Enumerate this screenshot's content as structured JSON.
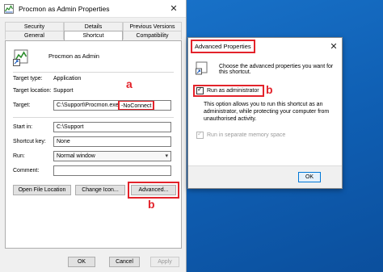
{
  "window_main": {
    "title": "Procmon as Admin Properties",
    "close_glyph": "✕",
    "tabs_row1": [
      "Security",
      "Details",
      "Previous Versions"
    ],
    "tabs_row2": [
      "General",
      "Shortcut",
      "Compatibility"
    ],
    "active_tab": "Shortcut",
    "shortcut_name": "Procmon as Admin",
    "fields": {
      "target_type_label": "Target type:",
      "target_type_value": "Application",
      "target_location_label": "Target location:",
      "target_location_value": "Support",
      "target_label": "Target:",
      "target_value_main": "C:\\Support\\Procmon.exe",
      "target_value_suffix": "-NoConnect",
      "start_in_label": "Start in:",
      "start_in_value": "C:\\Support",
      "shortcut_key_label": "Shortcut key:",
      "shortcut_key_value": "None",
      "run_label": "Run:",
      "run_value": "Normal window",
      "comment_label": "Comment:",
      "comment_value": ""
    },
    "buttons": {
      "open_file_location": "Open File Location",
      "change_icon": "Change Icon...",
      "advanced": "Advanced...",
      "ok": "OK",
      "cancel": "Cancel",
      "apply": "Apply"
    },
    "markers": {
      "a": "a",
      "b": "b"
    }
  },
  "window_advanced": {
    "title": "Advanced Properties",
    "close_glyph": "✕",
    "intro": "Choose the advanced properties you want for this shortcut.",
    "run_as_admin_label": "Run as administrator",
    "run_as_admin_checked": true,
    "description": "This option allows you to run this shortcut as an administrator, while protecting your computer from unauthorised activity.",
    "separate_memory_label": "Run in separate memory space",
    "separate_memory_checked": true,
    "ok": "OK",
    "marker": "b"
  },
  "icons": {
    "app_icon": "procmon-icon",
    "shortcut_icon": "shortcut-icon",
    "close": "close-icon",
    "dropdown": "chevron-down-icon"
  },
  "colors": {
    "highlight": "#e3232b",
    "desktop": "#1a6fc4",
    "dialog_bg": "#f0f0f0"
  }
}
